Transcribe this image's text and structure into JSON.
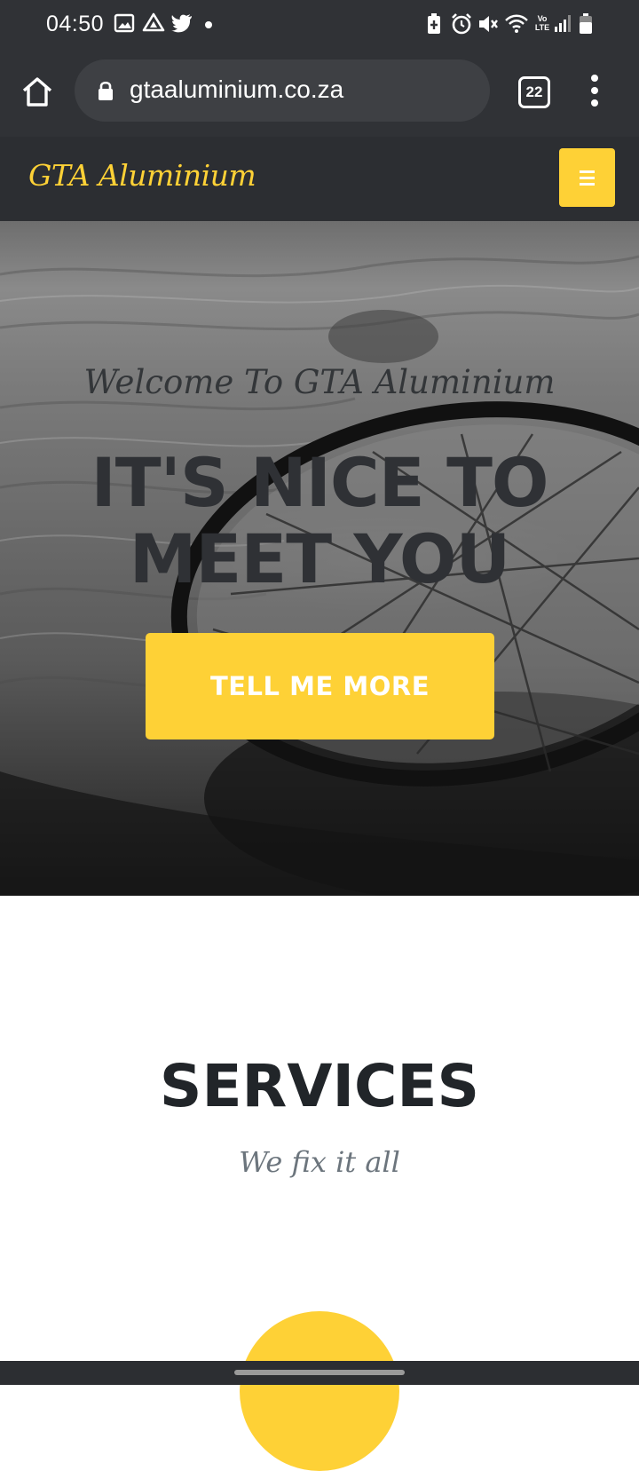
{
  "status_bar": {
    "time": "04:50",
    "left_icons": [
      "gallery-icon",
      "drive-icon",
      "twitter-icon",
      "notification-dot-icon"
    ],
    "right_icons": [
      "battery-saver-icon",
      "alarm-icon",
      "mute-icon",
      "wifi-icon",
      "volte-icon",
      "signal-icon",
      "battery-icon"
    ],
    "volte_label": "Vo LTE"
  },
  "browser": {
    "url": "gtaaluminium.co.za",
    "tab_count": "22"
  },
  "site": {
    "brand": "GTA Aluminium",
    "accent_color": "#fed136",
    "nav_bg": "#2c2e32"
  },
  "hero": {
    "subtitle": "Welcome To GTA Aluminium",
    "title": "IT'S NICE TO MEET YOU",
    "cta_label": "TELL ME MORE"
  },
  "services": {
    "heading": "SERVICES",
    "subheading": "We fix it all"
  }
}
